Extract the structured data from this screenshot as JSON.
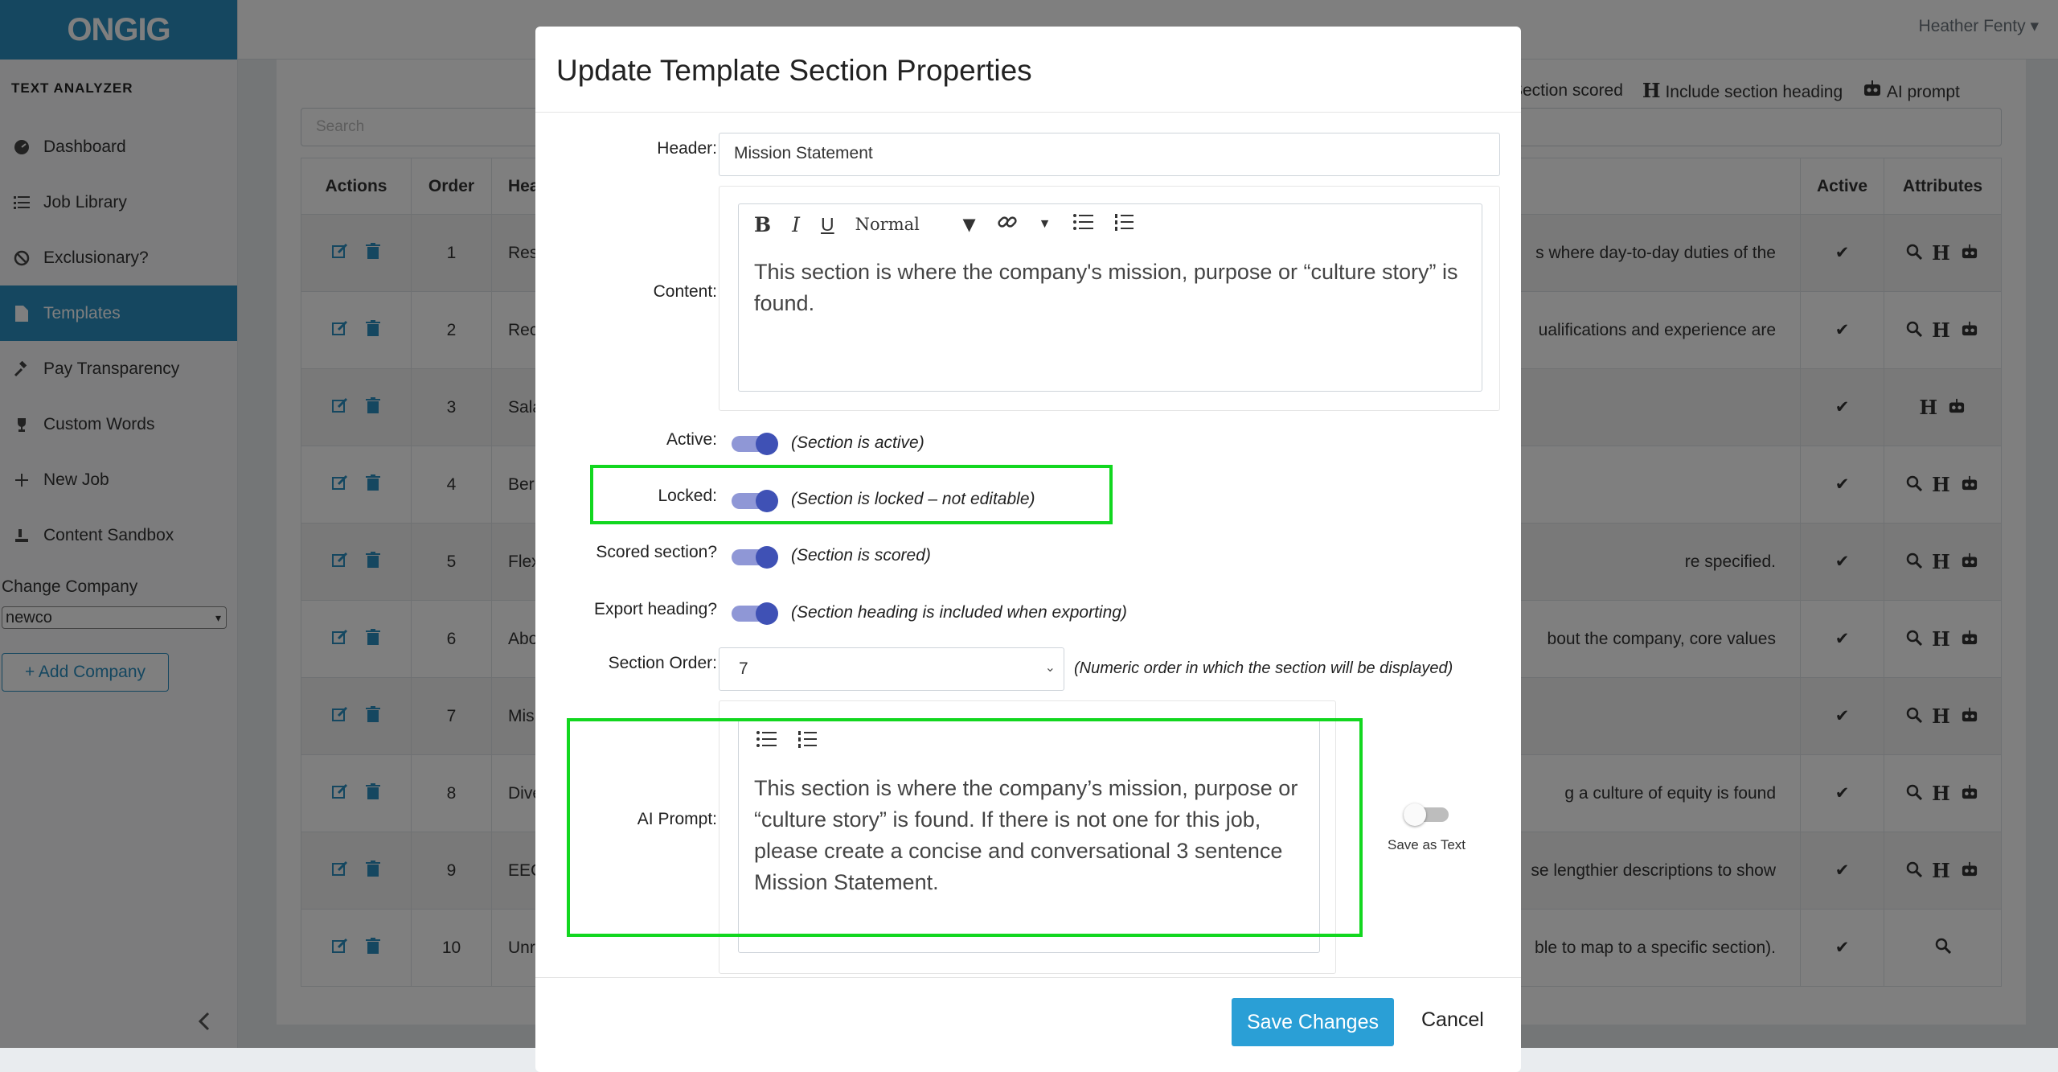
{
  "sidebar": {
    "logo": "ONGIG",
    "section_title": "TEXT ANALYZER",
    "items": [
      {
        "label": "Dashboard",
        "icon": "dashboard-icon"
      },
      {
        "label": "Job Library",
        "icon": "list-icon"
      },
      {
        "label": "Exclusionary?",
        "icon": "ban-icon"
      },
      {
        "label": "Templates",
        "icon": "file-icon",
        "active": true
      },
      {
        "label": "Pay Transparency",
        "icon": "gavel-icon"
      },
      {
        "label": "Custom Words",
        "icon": "trophy-icon"
      },
      {
        "label": "New Job",
        "icon": "plus-icon"
      },
      {
        "label": "Content Sandbox",
        "icon": "sandbox-icon"
      }
    ],
    "change_company_label": "Change Company",
    "company_selected": "newco",
    "add_company_label": "+ Add Company"
  },
  "topbar": {
    "user": "Heather Fenty"
  },
  "legend": {
    "scored": "Section scored",
    "heading": "Include section heading",
    "ai": "AI prompt"
  },
  "search": {
    "placeholder": "Search"
  },
  "table": {
    "headers": {
      "actions": "Actions",
      "order": "Order",
      "heading": "Hea",
      "active": "Active",
      "attributes": "Attributes"
    },
    "rows": [
      {
        "order": "1",
        "heading": "Res",
        "desc": "s where day-to-day duties of the",
        "attrs": "magnifier-icon H robot-icon"
      },
      {
        "order": "2",
        "heading": "Rec",
        "desc": "ualifications and experience are",
        "attrs": "magnifier-icon H robot-icon"
      },
      {
        "order": "3",
        "heading": "Sala",
        "desc": "",
        "attrs": "H robot-icon"
      },
      {
        "order": "4",
        "heading": "Ber",
        "desc": "",
        "attrs": "magnifier-icon H robot-icon"
      },
      {
        "order": "5",
        "heading": "Flex",
        "desc": "re specified.",
        "attrs": "magnifier-icon H robot-icon"
      },
      {
        "order": "6",
        "heading": "Abo",
        "desc": "bout the company, core values",
        "attrs": "magnifier-icon H robot-icon"
      },
      {
        "order": "7",
        "heading": "Mis",
        "desc": "",
        "attrs": "magnifier-icon H robot-icon"
      },
      {
        "order": "8",
        "heading": "Dive",
        "desc": "g a culture of equity is found",
        "attrs": "magnifier-icon H robot-icon"
      },
      {
        "order": "9",
        "heading": "EEC",
        "desc": "se lengthier descriptions to show",
        "attrs": "magnifier-icon H robot-icon"
      },
      {
        "order": "10",
        "heading": "Unr",
        "desc": "ble to map to a specific section).",
        "attrs": "magnifier-icon"
      }
    ]
  },
  "modal": {
    "title": "Update Template Section Properties",
    "header_label": "Header:",
    "header_value": "Mission Statement",
    "content_label": "Content:",
    "content_text": "This section is where the company's mission, purpose or “culture story” is found.",
    "format_select": "Normal",
    "active_label": "Active:",
    "active_hint": "(Section is active)",
    "locked_label": "Locked:",
    "locked_hint": "(Section is locked – not editable)",
    "scored_label": "Scored section?",
    "scored_hint": "(Section is scored)",
    "export_label": "Export heading?",
    "export_hint": "(Section heading is included when exporting)",
    "order_label": "Section Order:",
    "order_value": "7",
    "order_hint": "(Numeric order in which the section will be displayed)",
    "ai_label": "AI Prompt:",
    "ai_text": "This section is where the company’s mission, purpose or “culture story” is found. If there is not one for this job, please create a concise and conversational 3 sentence Mission Statement.",
    "save_as_text": "Save as Text",
    "save_button": "Save Changes",
    "cancel_button": "Cancel"
  },
  "colors": {
    "accent": "#2a8fc0",
    "toggle": "#3f51b5",
    "highlight": "#12d71f"
  }
}
